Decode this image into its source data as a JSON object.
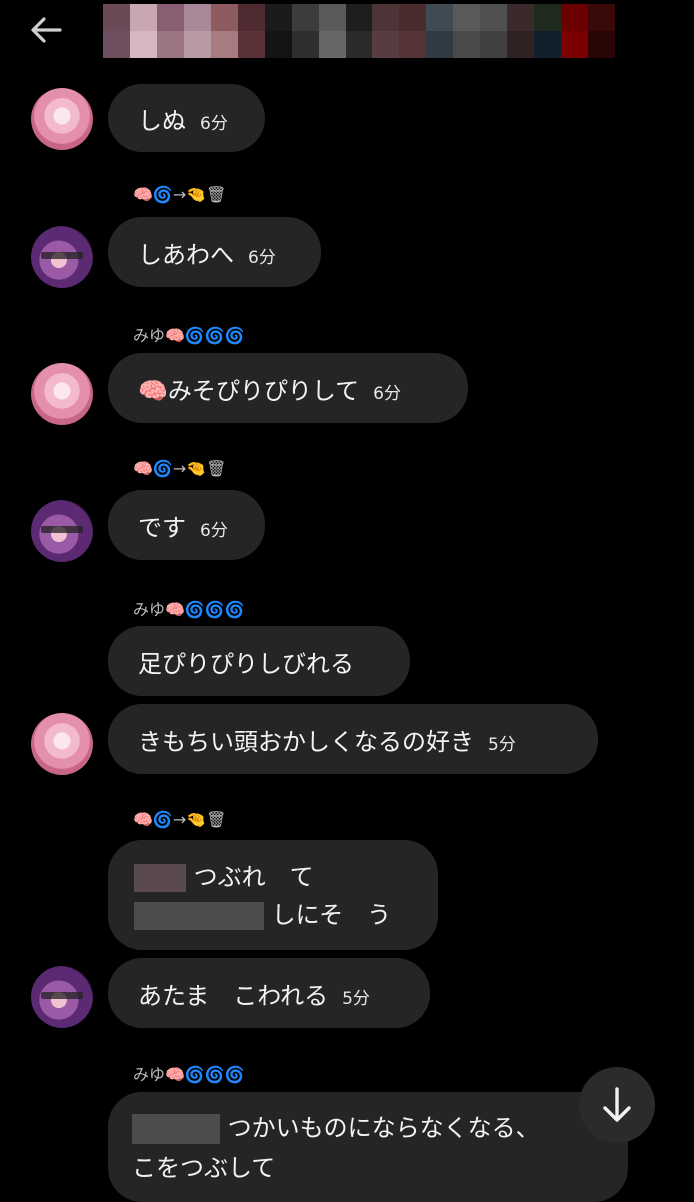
{
  "header": {
    "back_icon": "arrow-left-icon",
    "mosaic_colors": [
      "#6b4a58",
      "#c9a7b2",
      "#8a5f74",
      "#a88798",
      "#8e5b61",
      "#4f2a30",
      "#1b1b1b",
      "#3c3c3c",
      "#5a5a5a",
      "#1e1e1e",
      "#4d3436",
      "#4a2b2e",
      "#3f4a52",
      "#5a5a5a",
      "#505050",
      "#3b2a2c",
      "#1f2b1e",
      "#6b0000",
      "#3a0a0a",
      "#6e4f5f",
      "#d6b6c1",
      "#9a7483",
      "#b89aa6",
      "#a77b80",
      "#5a3338",
      "#141414",
      "#2e2e2e",
      "#676767",
      "#2a2a2a",
      "#573d3f",
      "#553437",
      "#2f3a42",
      "#4a4a4a",
      "#404040",
      "#2e2222",
      "#12202b",
      "#7a0000",
      "#2a0505"
    ]
  },
  "reactions": {
    "a": "🧠🌀→🤏🗑",
    "b": "みゆ🧠🌀🌀🌀"
  },
  "messages": {
    "m1": {
      "text": "しぬ",
      "time": "6分"
    },
    "m2": {
      "text": "しあわへ",
      "time": "6分"
    },
    "m3": {
      "text": "🧠みそぴりぴりして",
      "time": "6分"
    },
    "m4": {
      "text": "です",
      "time": "6分"
    },
    "m5": {
      "text": "足ぴりぴりしびれる"
    },
    "m6": {
      "text": "きもちい頭おかしくなるの好き",
      "time": "5分"
    },
    "m7": {
      "line1": "つぶれ　て",
      "line2": "しにそ　う"
    },
    "m8": {
      "text": "あたま　こわれる",
      "time": "5分"
    },
    "m9": {
      "line1": "つかいものにならなくなる、",
      "line2": "こをつぶして"
    }
  },
  "scroll_down_icon": "arrow-down-icon"
}
